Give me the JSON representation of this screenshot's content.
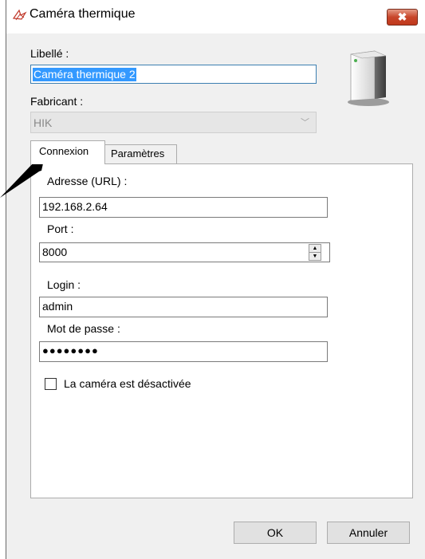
{
  "window": {
    "title": "Caméra thermique",
    "close_label": "✖"
  },
  "form": {
    "libelle_label": "Libellé :",
    "libelle_value": "Caméra thermique 2",
    "fabricant_label": "Fabricant :",
    "fabricant_value": "HIK",
    "chevron": "﹀"
  },
  "tabs": [
    {
      "label": "Connexion",
      "active": true
    },
    {
      "label": "Paramètres",
      "active": false
    }
  ],
  "connexion": {
    "adresse_label": "Adresse (URL) :",
    "adresse_value": "192.168.2.64",
    "port_label": "Port :",
    "port_value": "8000",
    "login_label": "Login :",
    "login_value": "admin",
    "password_label": "Mot de passe :",
    "password_value": "●●●●●●●●",
    "disabled_checkbox_label": "La caméra est désactivée",
    "disabled_checked": false
  },
  "buttons": {
    "ok": "OK",
    "cancel": "Annuler"
  },
  "icons": {
    "app": "camera-app-icon",
    "device": "server-icon",
    "spin_up": "▲",
    "spin_down": "▼"
  },
  "colors": {
    "selection": "#3399ff",
    "close_button": "#c8452a",
    "focus_border": "#3c7fb1"
  }
}
